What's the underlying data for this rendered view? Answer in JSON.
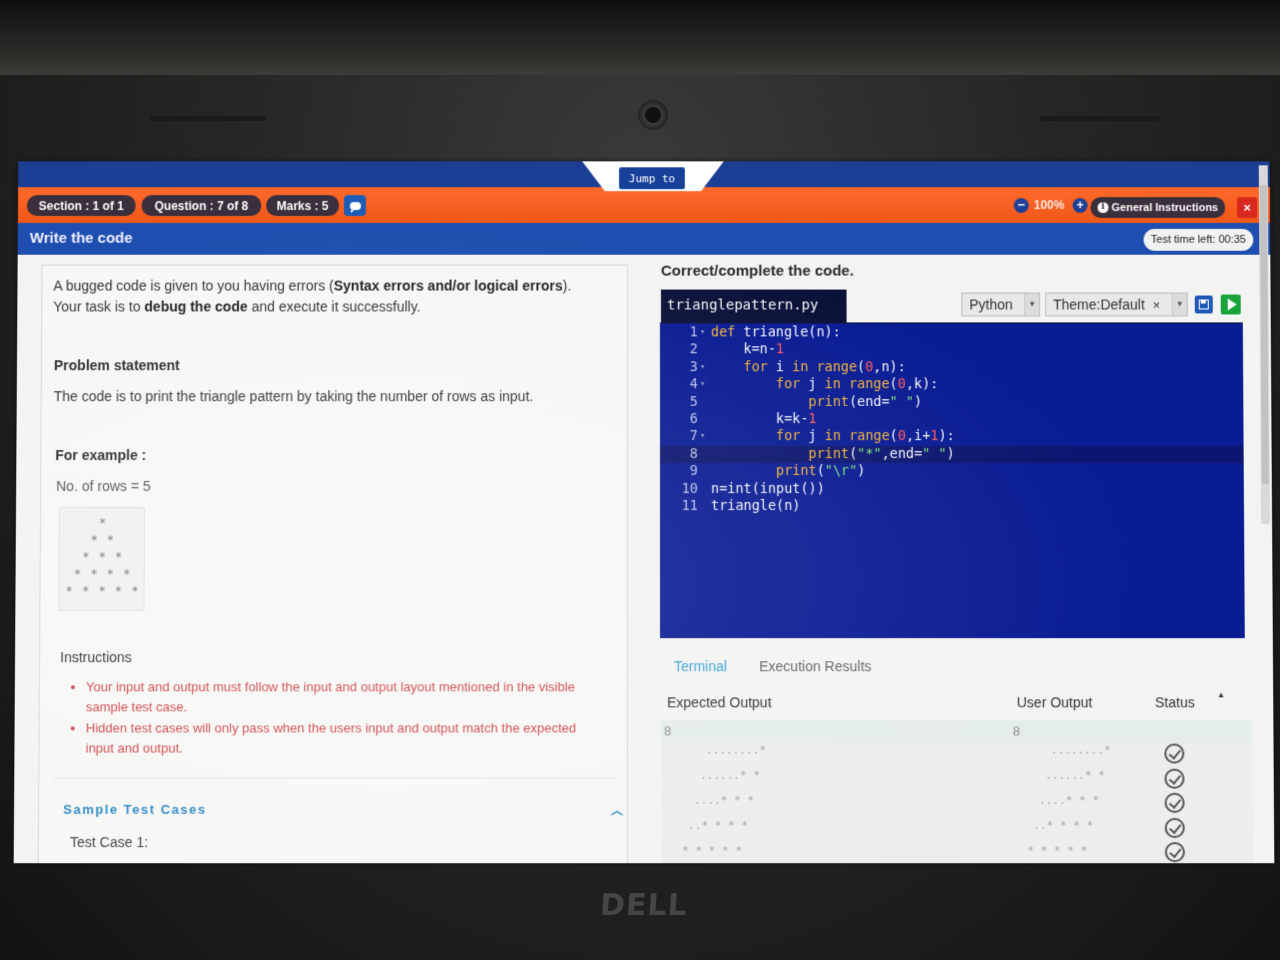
{
  "nav": {
    "jump_label": "Jump to",
    "section": "Section : 1 of 1",
    "question": "Question : 7 of 8",
    "marks": "Marks : 5",
    "zoom": "100%",
    "general_instructions": "General Instructions",
    "close_label": "×"
  },
  "title_bar": {
    "title": "Write the code",
    "timer": "Test time left: 00:35"
  },
  "left_panel": {
    "intro": {
      "p1_before": "A bugged code is given to you having errors (",
      "p1_bold": "Syntax errors and/or logical errors",
      "p1_after": ").",
      "p2_before": "Your task is to ",
      "p2_bold": "debug the code",
      "p2_after": " and execute it successfully."
    },
    "problem_heading": "Problem statement",
    "problem_text": "The code is to print the triangle pattern by taking the number of rows as input.",
    "example_heading": "For example :",
    "rows_text": "No. of rows = 5",
    "pattern_rows": [
      "*",
      "* *",
      "* * *",
      "* * * *",
      "* * * * *"
    ],
    "instructions_heading": "Instructions",
    "instructions": [
      "Your input and output must follow the input and output layout mentioned in the visible sample test case.",
      "Hidden test cases will only pass when the users input and output match the expected input and output."
    ],
    "sample_label": "Sample  Test  Cases",
    "test_case_1": "Test Case 1:"
  },
  "editor": {
    "header": "Correct/complete the code.",
    "filename": "trianglepattern.py",
    "language": "Python",
    "theme": "Theme:Default",
    "theme_clear": "×",
    "lines": [
      {
        "n": "1",
        "fold": "▾",
        "indent": "",
        "parts": [
          [
            "kw",
            "def "
          ],
          [
            "t",
            "triangle(n):"
          ]
        ]
      },
      {
        "n": "2",
        "fold": "",
        "indent": "    ",
        "parts": [
          [
            "t",
            "k=n-"
          ],
          [
            "num",
            "1"
          ]
        ]
      },
      {
        "n": "3",
        "fold": "▾",
        "indent": "    ",
        "parts": [
          [
            "kw",
            "for "
          ],
          [
            "t",
            "i "
          ],
          [
            "kw",
            "in "
          ],
          [
            "kw",
            "range"
          ],
          [
            "t",
            "("
          ],
          [
            "num",
            "0"
          ],
          [
            "t",
            ",n):"
          ]
        ]
      },
      {
        "n": "4",
        "fold": "▾",
        "indent": "        ",
        "parts": [
          [
            "kw",
            "for "
          ],
          [
            "t",
            "j "
          ],
          [
            "kw",
            "in "
          ],
          [
            "kw",
            "range"
          ],
          [
            "t",
            "("
          ],
          [
            "num",
            "0"
          ],
          [
            "t",
            ",k):"
          ]
        ]
      },
      {
        "n": "5",
        "fold": "",
        "indent": "            ",
        "parts": [
          [
            "kw",
            "print"
          ],
          [
            "t",
            "(end="
          ],
          [
            "str",
            "\" \""
          ],
          [
            "t",
            ")"
          ]
        ]
      },
      {
        "n": "6",
        "fold": "",
        "indent": "        ",
        "parts": [
          [
            "t",
            "k=k-"
          ],
          [
            "num",
            "1"
          ]
        ]
      },
      {
        "n": "7",
        "fold": "▾",
        "indent": "        ",
        "parts": [
          [
            "kw",
            "for "
          ],
          [
            "t",
            "j "
          ],
          [
            "kw",
            "in "
          ],
          [
            "kw",
            "range"
          ],
          [
            "t",
            "("
          ],
          [
            "num",
            "0"
          ],
          [
            "t",
            ",i+"
          ],
          [
            "num",
            "1"
          ],
          [
            "t",
            "):"
          ]
        ]
      },
      {
        "n": "8",
        "fold": "",
        "indent": "            ",
        "parts": [
          [
            "kw",
            "print"
          ],
          [
            "t",
            "("
          ],
          [
            "str",
            "\"*\""
          ],
          [
            "t",
            ",end="
          ],
          [
            "str",
            "\" \""
          ],
          [
            "t",
            ")"
          ]
        ]
      },
      {
        "n": "9",
        "fold": "",
        "indent": "        ",
        "parts": [
          [
            "kw",
            "print"
          ],
          [
            "t",
            "("
          ],
          [
            "str",
            "\"\\r\""
          ],
          [
            "t",
            ")"
          ]
        ]
      },
      {
        "n": "10",
        "fold": "",
        "indent": "",
        "parts": [
          [
            "t",
            "n=int(input())"
          ]
        ]
      },
      {
        "n": "11",
        "fold": "",
        "indent": "",
        "parts": [
          [
            "t",
            "triangle(n)"
          ]
        ]
      }
    ]
  },
  "output": {
    "tab_terminal": "Terminal",
    "tab_exec": "Execution Results",
    "col_expected": "Expected Output",
    "col_user": "User Output",
    "col_status": "Status",
    "expected_value": "8",
    "user_value": "8",
    "pattern_rows": [
      "*",
      "* *",
      "* * *",
      "* * * *",
      "* * * * *"
    ],
    "status_count": 5
  },
  "colors": {
    "orange_bar": "#f05718",
    "blue_bar": "#1e4fb0",
    "editor_bg": "#0a1c93",
    "keyword": "#f3b43a",
    "number": "#ff5a5a",
    "string": "#7ce07c",
    "run_button": "#18a43a",
    "close_button": "#d8281f"
  },
  "bezel": {
    "brand": "DELL"
  }
}
